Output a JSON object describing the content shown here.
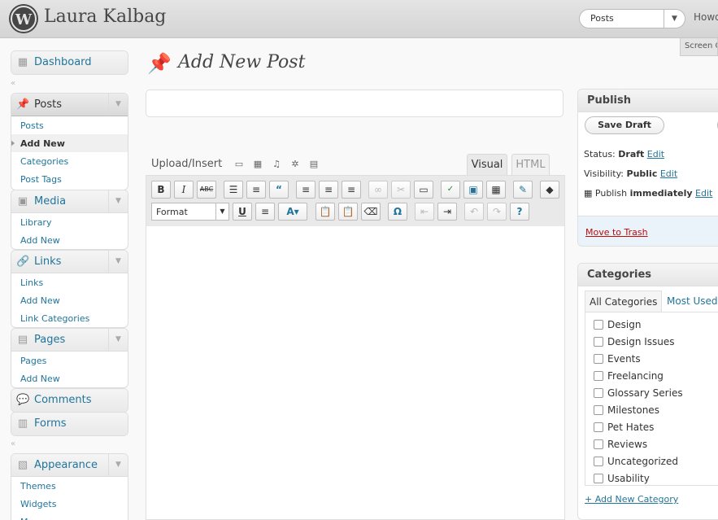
{
  "header": {
    "logo_glyph": "W",
    "site_title": "Laura Kalbag",
    "favorite_action": "Posts",
    "howdy": "Howd",
    "screen_options": "Screen O"
  },
  "sidebar": {
    "dashboard": "Dashboard",
    "posts": {
      "label": "Posts",
      "items": [
        "Posts",
        "Add New",
        "Categories",
        "Post Tags"
      ]
    },
    "media": {
      "label": "Media",
      "items": [
        "Library",
        "Add New"
      ]
    },
    "links": {
      "label": "Links",
      "items": [
        "Links",
        "Add New",
        "Link Categories"
      ]
    },
    "pages": {
      "label": "Pages",
      "items": [
        "Pages",
        "Add New"
      ]
    },
    "comments": "Comments",
    "forms": "Forms",
    "appearance": {
      "label": "Appearance",
      "items": [
        "Themes",
        "Widgets",
        "Menus"
      ]
    }
  },
  "main": {
    "page_title": "Add New Post",
    "title_value": "",
    "upload_label": "Upload/Insert",
    "tab_visual": "Visual",
    "tab_html": "HTML",
    "format_select": "Format",
    "body_value": ""
  },
  "publish": {
    "title": "Publish",
    "save_draft": "Save Draft",
    "status_label": "Status:",
    "status_value": "Draft",
    "visibility_label": "Visibility:",
    "visibility_value": "Public",
    "publish_label": "Publish",
    "publish_value": "immediately",
    "edit": "Edit",
    "move_to_trash": "Move to Trash"
  },
  "categories": {
    "title": "Categories",
    "tab_all": "All Categories",
    "tab_used": "Most Used",
    "items": [
      "Design",
      "Design Issues",
      "Events",
      "Freelancing",
      "Glossary Series",
      "Milestones",
      "Pet Hates",
      "Reviews",
      "Uncategorized",
      "Usability"
    ],
    "add_new": "+ Add New Category"
  },
  "colors": {
    "link": "#21759b",
    "trash": "#bc0b0b",
    "header_bg": "#d4d4d4"
  }
}
